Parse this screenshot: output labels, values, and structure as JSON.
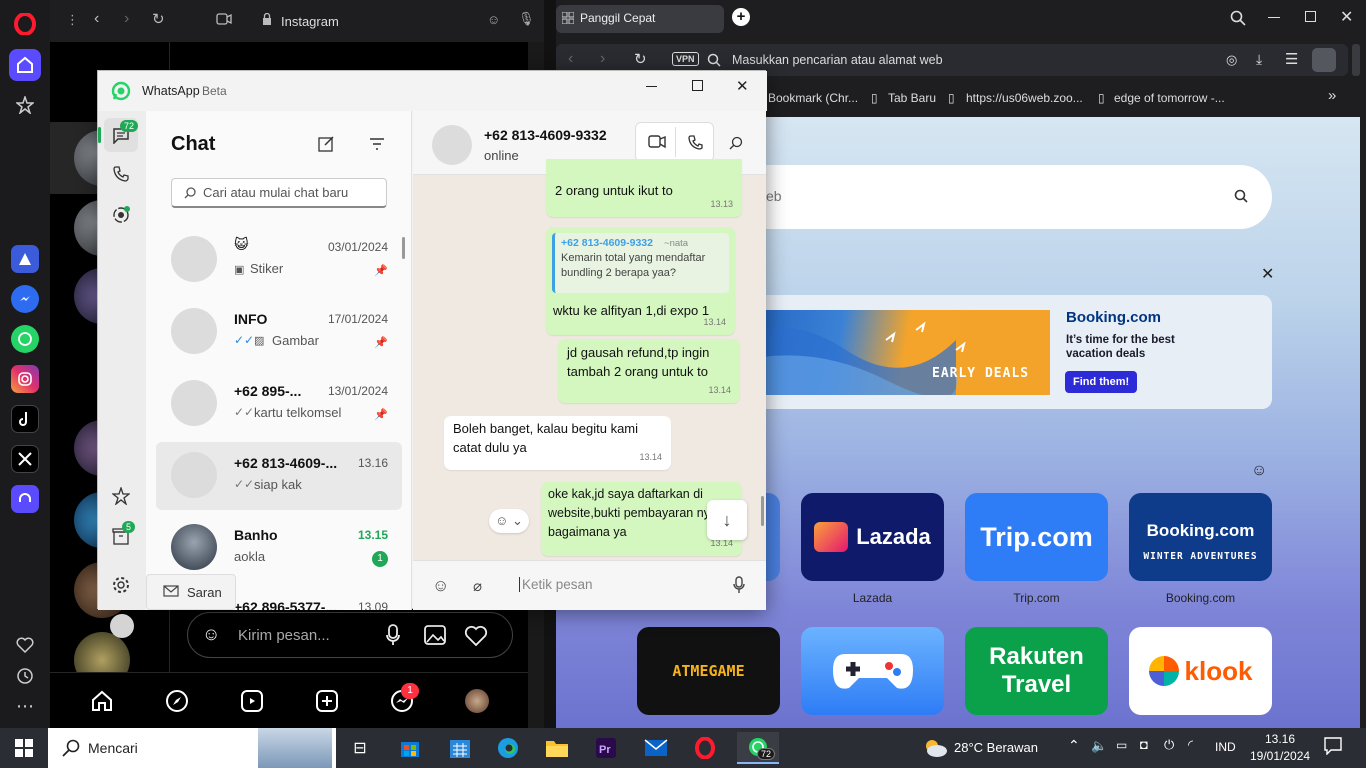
{
  "ig": {
    "title": "Instagram",
    "message_placeholder": "Kirim pesan...",
    "messenger_badge": "1"
  },
  "browser": {
    "tab_title": "Panggil Cepat",
    "address_placeholder": "Masukkan pencarian atau alamat web",
    "vpn": "VPN",
    "bookmarks": [
      "Bookmark (Chr...",
      "Tab Baru",
      "https://us06web.zoo...",
      "edge of tomorrow -..."
    ],
    "search_placeholder": "eb",
    "ad": {
      "brand": "Booking.com",
      "tagline": "It’s time for the best vacation deals",
      "cta": "Find them!",
      "banner": "EARLY DEALS"
    },
    "tiles": [
      {
        "name": "Lazada",
        "logo": "Lazada",
        "color": "#0f1a6b"
      },
      {
        "name": "Trip.com",
        "logo": "Trip.com",
        "color": "#2e7cf6"
      },
      {
        "name": "Booking.com",
        "logo": "Booking.com",
        "sub": "WINTER ADVENTURES",
        "color": "#0e3b8a"
      }
    ],
    "tiles2": [
      {
        "logo": "ATMEGAME",
        "color": "#111"
      },
      {
        "logo": "",
        "color": "#3a8af2"
      },
      {
        "logo": "Rakuten Travel",
        "color": "#0aa14a"
      },
      {
        "logo": "klook",
        "color": "#ffffff"
      }
    ]
  },
  "wa": {
    "app_name": "WhatsApp",
    "beta": "Beta",
    "unread_badge": "72",
    "status_badge": "5",
    "list_title": "Chat",
    "search_placeholder": "Cari atau mulai chat baru",
    "feedback": "Saran",
    "chats": [
      {
        "name": "",
        "time": "03/01/2024",
        "preview": "Stiker"
      },
      {
        "name": "INFO",
        "time": "17/01/2024",
        "preview": "Gambar"
      },
      {
        "name": "+62 895-...",
        "time": "13/01/2024",
        "preview": "kartu telkomsel"
      },
      {
        "name": "+62 813-4609-...",
        "time": "13.16",
        "preview": "siap kak"
      },
      {
        "name": "Banho",
        "time": "13.15",
        "preview": "aokla",
        "badge": "1"
      },
      {
        "name": "+62 896-5377-...",
        "time": "13.09",
        "preview": ""
      }
    ],
    "contact": {
      "name": "+62 813-4609-9332",
      "status": "online"
    },
    "messages": [
      {
        "text": "2 orang untuk ikut to",
        "time": "13.13"
      },
      {
        "quote_author": "+62 813-4609-9332",
        "quote_tag": "~nata",
        "quote_text": "Kemarin total yang mendaftar bundling 2 berapa yaa?",
        "text": "wktu ke alfityan 1,di expo 1",
        "time": "13.14"
      },
      {
        "text": "jd gausah refund,tp ingin tambah 2 orang untuk to",
        "time": "13.14"
      },
      {
        "text": "Boleh banget, kalau begitu kami catat dulu ya",
        "time": "13.14"
      },
      {
        "text": "oke kak,jd saya daftarkan di website,bukti pembayaran nya bagaimana ya",
        "time": "13.14"
      }
    ],
    "composer_placeholder": "Ketik pesan"
  },
  "taskbar": {
    "search": "Mencari",
    "weather": "28°C  Berawan",
    "lang": "IND",
    "time": "13.16",
    "date": "19/01/2024",
    "wa_badge": "72"
  }
}
